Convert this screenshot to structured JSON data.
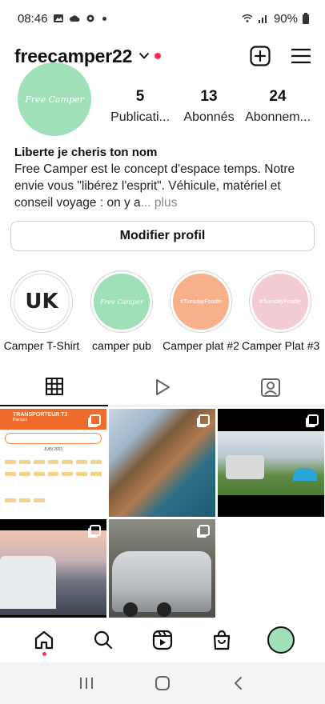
{
  "status": {
    "time": "08:46",
    "battery": "90%"
  },
  "header": {
    "username": "freecamper22"
  },
  "profile": {
    "avatar_text": "Free Camper",
    "stats": [
      {
        "value": "5",
        "label": "Publicati..."
      },
      {
        "value": "13",
        "label": "Abonnés"
      },
      {
        "value": "24",
        "label": "Abonnem..."
      }
    ],
    "bio_name": "Liberte je cheris ton nom",
    "bio_text": "Free Camper est le concept d'espace temps. Notre envie vous \"libérez l'esprit\". Véhicule, matériel et conseil voyage : on y a",
    "bio_more": "... plus",
    "edit_button": "Modifier profil"
  },
  "highlights": [
    {
      "label": "Camper T-Shirt",
      "circle_text": "UK",
      "color": "#ffffff"
    },
    {
      "label": "camper pub",
      "circle_text": "Free Camper",
      "color": "#9fe0b9"
    },
    {
      "label": "Camper plat #2",
      "circle_text": "#TuesdayFoodie",
      "color": "#f8b08a"
    },
    {
      "label": "Camper Plat #3",
      "circle_text": "#TuesdayFoodie",
      "color": "#f3ccd3"
    }
  ],
  "grid_post1": {
    "title": "TRANSPORTEUR T3",
    "subtitle": "Paimpol",
    "month": "JUIN 2021"
  },
  "colors": {
    "accent_red": "#ff2d55",
    "brand_green": "#9fe0b9",
    "calendar_orange": "#ee6b2b"
  }
}
